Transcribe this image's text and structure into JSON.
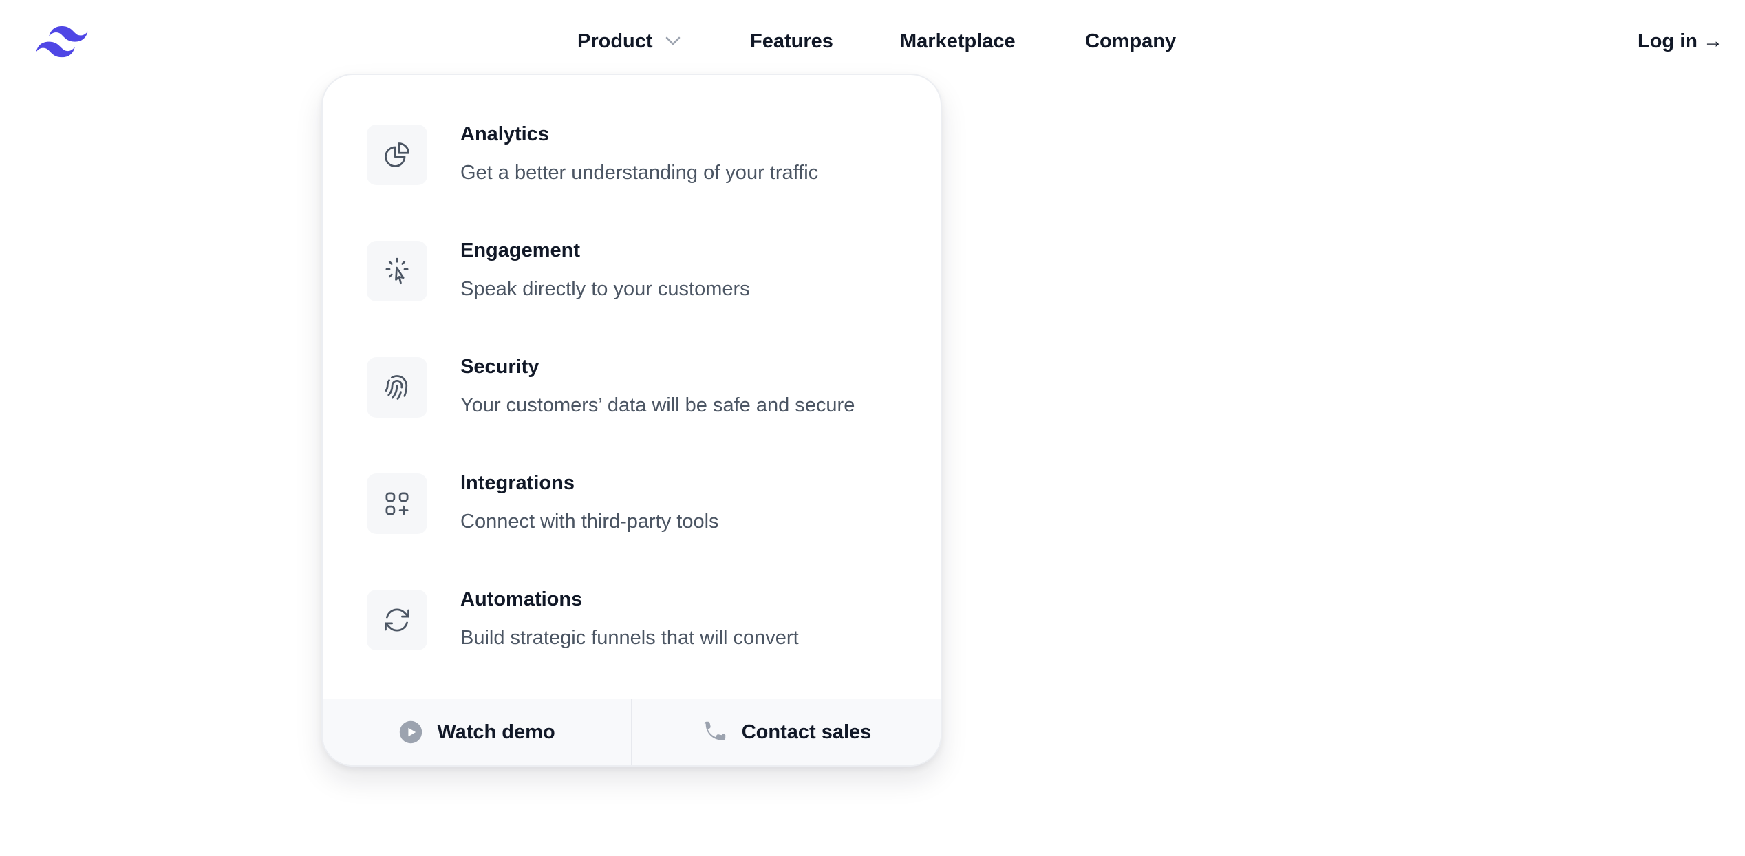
{
  "brand": {
    "logo_icon": "tailwind-waves-logo",
    "accent": "#4f46e5"
  },
  "nav": {
    "items": [
      {
        "label": "Product",
        "icon": "chevron-down-icon"
      },
      {
        "label": "Features"
      },
      {
        "label": "Marketplace"
      },
      {
        "label": "Company"
      }
    ],
    "login_label": "Log in →"
  },
  "product_menu": {
    "items": [
      {
        "title": "Analytics",
        "description": "Get a better understanding of your traffic",
        "icon": "pie-chart-icon"
      },
      {
        "title": "Engagement",
        "description": "Speak directly to your customers",
        "icon": "cursor-click-icon"
      },
      {
        "title": "Security",
        "description": "Your customers’ data will be safe and secure",
        "icon": "fingerprint-icon"
      },
      {
        "title": "Integrations",
        "description": "Connect with third-party tools",
        "icon": "squares-plus-icon"
      },
      {
        "title": "Automations",
        "description": "Build strategic funnels that will convert",
        "icon": "arrow-path-icon"
      }
    ],
    "footer": [
      {
        "label": "Watch demo",
        "icon": "play-circle-icon"
      },
      {
        "label": "Contact sales",
        "icon": "phone-icon"
      }
    ]
  }
}
